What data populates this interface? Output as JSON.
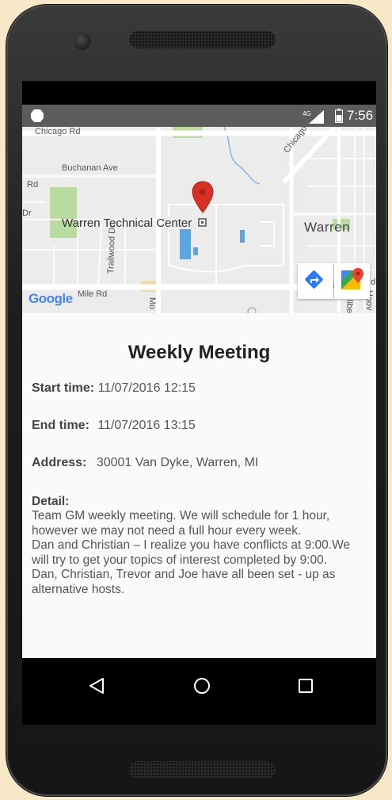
{
  "status_bar": {
    "network": "4G",
    "time": "7:56"
  },
  "map": {
    "labels": {
      "chicago_rd": "Chicago Rd",
      "chicago_rd_diag": "Chicago Rd",
      "buchanan": "Buchanan Ave",
      "rd_left": "Rd",
      "dr_left": "Dr",
      "trailwood": "Trailwood Dr",
      "mile_rd": "Mile Rd",
      "mo": "Mo",
      "rd_right": "Rd",
      "hoov": "Hoov",
      "lilbe": "libe",
      "wolve": "wolve",
      "warren_city": "Warren",
      "place": "Warren Technical Center",
      "google": "Google"
    },
    "buttons": [
      "directions-button",
      "open-in-maps-button"
    ]
  },
  "event": {
    "title": "Weekly Meeting",
    "start_label": "Start time:",
    "start_value": "11/07/2016 12:15",
    "end_label": "End time:",
    "end_value": "11/07/2016 13:15",
    "address_label": "Address:",
    "address_value": "30001 Van Dyke, Warren, MI",
    "detail_label": "Detail:",
    "detail_lines": [
      "Team GM weekly meeting. We will schedule for 1 hour,",
      "however we may not need a full hour every week.",
      "Dan and Christian – I realize you have conflicts at 9:00.We",
      "will try to get your topics of interest completed by 9:00.",
      "Dan, Christian, Trevor and Joe have all been set - up as",
      "alternative hosts."
    ]
  },
  "colors": {
    "background": "#f7e8c8",
    "status_bar": "#5c5c5c",
    "map_bg": "#ececec",
    "pin": "#d93025",
    "park_green": "#b9dc9e",
    "water_blue": "#5ba4e6",
    "nav_bar": "#000000"
  }
}
